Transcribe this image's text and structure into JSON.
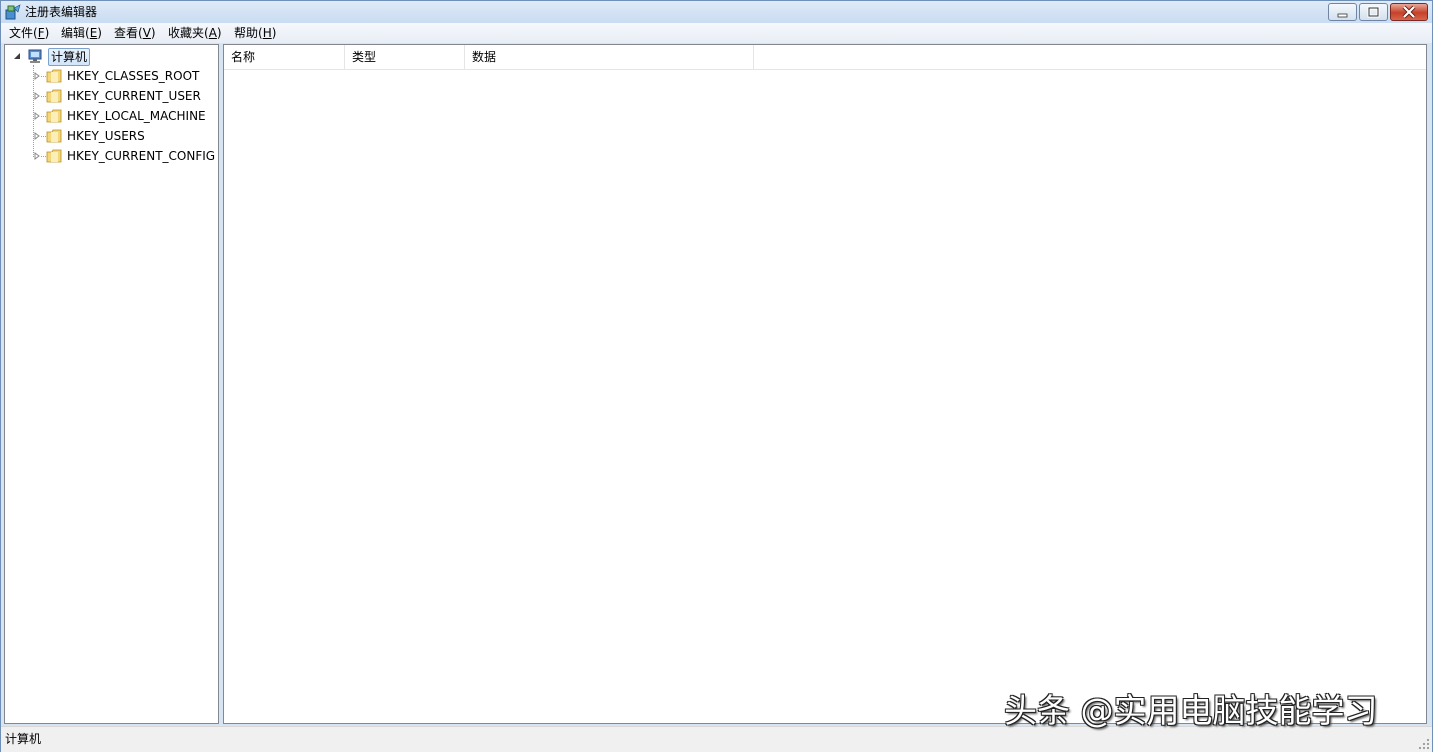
{
  "window": {
    "title": "注册表编辑器"
  },
  "menu": [
    {
      "label": "文件",
      "accel": "F"
    },
    {
      "label": "编辑",
      "accel": "E"
    },
    {
      "label": "查看",
      "accel": "V"
    },
    {
      "label": "收藏夹",
      "accel": "A"
    },
    {
      "label": "帮助",
      "accel": "H"
    }
  ],
  "tree": {
    "root": "计算机",
    "keys": [
      "HKEY_CLASSES_ROOT",
      "HKEY_CURRENT_USER",
      "HKEY_LOCAL_MACHINE",
      "HKEY_USERS",
      "HKEY_CURRENT_CONFIG"
    ]
  },
  "list": {
    "columns": [
      "名称",
      "类型",
      "数据"
    ]
  },
  "status": {
    "path": "计算机"
  },
  "watermark": "头条 @实用电脑技能学习",
  "colors": {
    "titlebar": "#c9dcf1",
    "close_button": "#c6412a",
    "folder": "#e8c75a",
    "selection": "#d2e5fa"
  }
}
